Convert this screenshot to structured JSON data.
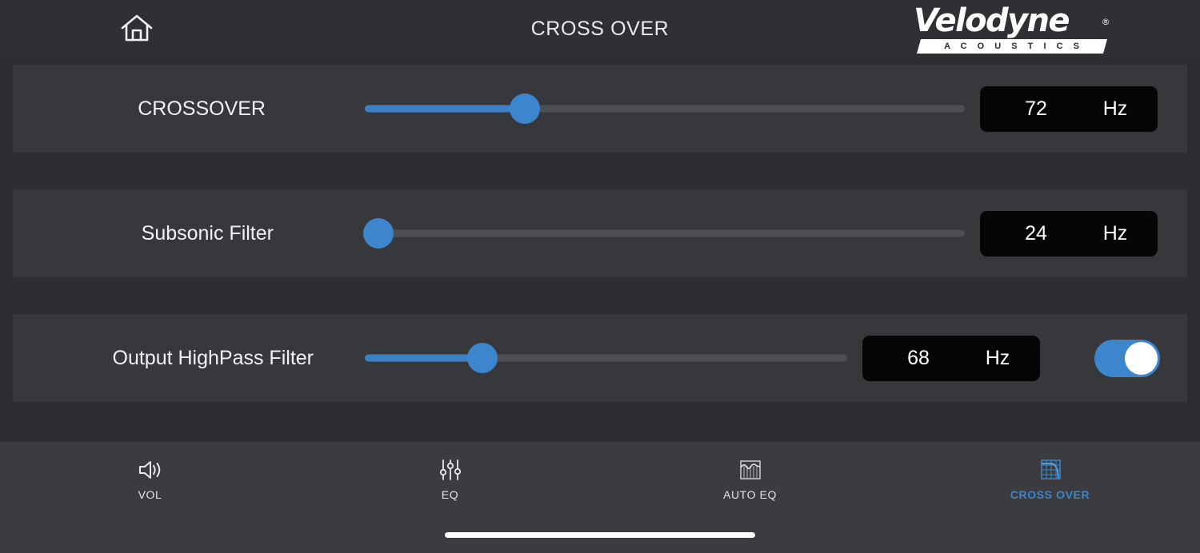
{
  "header": {
    "home_icon": "home-icon",
    "title": "CROSS OVER",
    "logo": {
      "word": "Velodyne",
      "registered": "®",
      "band": "A C O U S T I C S"
    }
  },
  "colors": {
    "accent_blue": "#3d85cc",
    "page_bg": "#2b2d31",
    "row_bg": "#36383c",
    "navbar_bg": "#3a3c40",
    "value_box_bg": "#050505",
    "track_bg": "#4d4f53"
  },
  "rows": [
    {
      "label": "CROSSOVER",
      "slider": {
        "percent": 26.7
      },
      "value": "72",
      "unit": "Hz",
      "has_toggle": false
    },
    {
      "label": "Subsonic Filter",
      "slider": {
        "percent": 2.2
      },
      "value": "24",
      "unit": "Hz",
      "has_toggle": false
    },
    {
      "label": "Output HighPass Filter",
      "slider": {
        "percent": 24.4
      },
      "value": "68",
      "unit": "Hz",
      "has_toggle": true,
      "toggle_state": "on"
    }
  ],
  "navbar": {
    "items": [
      {
        "label": "VOL",
        "icon": "speaker-volume-icon",
        "active": false
      },
      {
        "label": "EQ",
        "icon": "equalizer-sliders-icon",
        "active": false
      },
      {
        "label": "AUTO EQ",
        "icon": "auto-eq-graph-icon",
        "active": false
      },
      {
        "label": "CROSS OVER",
        "icon": "crossover-curve-icon",
        "active": true
      }
    ],
    "home_indicator": "home-indicator-bar"
  }
}
